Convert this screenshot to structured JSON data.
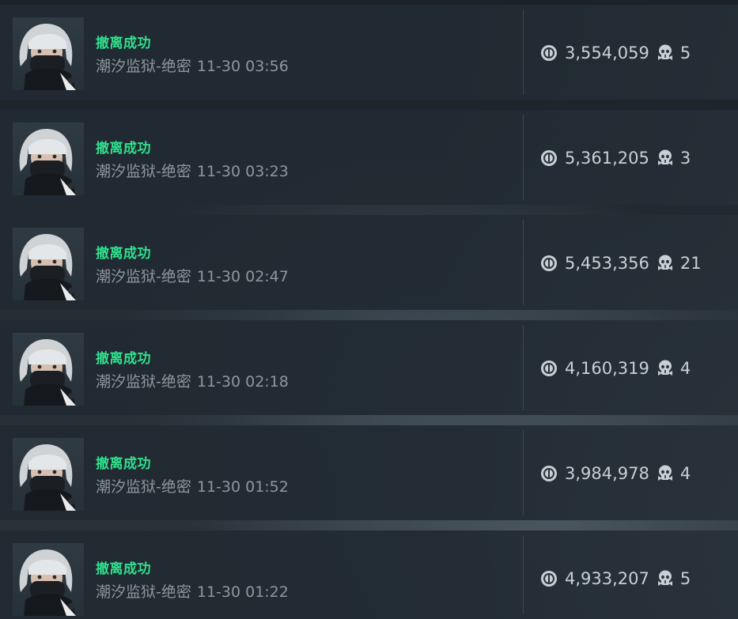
{
  "matches": [
    {
      "status": "撤离成功",
      "map": "潮汐监狱-绝密",
      "time": "11-30 03:56",
      "value": "3,554,059",
      "kills": "5"
    },
    {
      "status": "撤离成功",
      "map": "潮汐监狱-绝密",
      "time": "11-30 03:23",
      "value": "5,361,205",
      "kills": "3"
    },
    {
      "status": "撤离成功",
      "map": "潮汐监狱-绝密",
      "time": "11-30 02:47",
      "value": "5,453,356",
      "kills": "21"
    },
    {
      "status": "撤离成功",
      "map": "潮汐监狱-绝密",
      "time": "11-30 02:18",
      "value": "4,160,319",
      "kills": "4"
    },
    {
      "status": "撤离成功",
      "map": "潮汐监狱-绝密",
      "time": "11-30 01:52",
      "value": "3,984,978",
      "kills": "4"
    },
    {
      "status": "撤离成功",
      "map": "潮汐监狱-绝密",
      "time": "11-30 01:22",
      "value": "4,933,207",
      "kills": "5"
    }
  ],
  "icons": {
    "value": "coin-icon",
    "kills": "skull-icon"
  },
  "colors": {
    "status_success": "#2fe08d",
    "secondary_text": "#8d979e",
    "stat_text": "#c9d0d5",
    "row_background": "#212a32"
  }
}
